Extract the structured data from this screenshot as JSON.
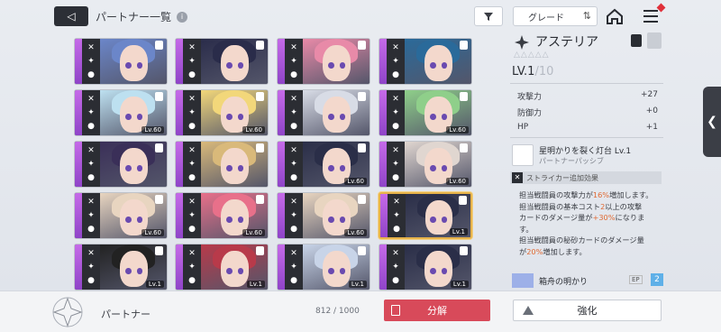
{
  "header": {
    "back_glyph": "◁",
    "title": "パートナー一覧",
    "info_glyph": "i",
    "sort_label": "グレード",
    "sort_order_glyph": "⇅"
  },
  "cards": [
    {
      "level": "",
      "hair": "#6b86c9",
      "selected": false
    },
    {
      "level": "",
      "hair": "#2a2c4a",
      "selected": false
    },
    {
      "level": "",
      "hair": "#e88aa8",
      "selected": false
    },
    {
      "level": "",
      "hair": "#2a6a9a",
      "selected": false
    },
    {
      "level": "Lv.60",
      "hair": "#bde0f0",
      "selected": false
    },
    {
      "level": "Lv.60",
      "hair": "#f2d77a",
      "selected": false
    },
    {
      "level": "",
      "hair": "#d8dce6",
      "selected": false
    },
    {
      "level": "Lv.60",
      "hair": "#8fcf8a",
      "selected": false
    },
    {
      "level": "",
      "hair": "#3a2f58",
      "selected": false
    },
    {
      "level": "",
      "hair": "#d9b97a",
      "selected": false
    },
    {
      "level": "Lv.60",
      "hair": "#2a2e48",
      "selected": false
    },
    {
      "level": "Lv.60",
      "hair": "#e0d6d0",
      "selected": false
    },
    {
      "level": "Lv.60",
      "hair": "#e8d5c0",
      "selected": false
    },
    {
      "level": "Lv.60",
      "hair": "#e8708a",
      "selected": false
    },
    {
      "level": "Lv.60",
      "hair": "#e8d5c0",
      "selected": false
    },
    {
      "level": "Lv.1",
      "hair": "#2a2e48",
      "selected": true
    },
    {
      "level": "Lv.1",
      "hair": "#222",
      "selected": false
    },
    {
      "level": "Lv.1",
      "hair": "#b83a4a",
      "selected": false
    },
    {
      "level": "Lv.1",
      "hair": "#c8d4e8",
      "selected": false
    },
    {
      "level": "Lv.1",
      "hair": "#2a2e48",
      "selected": false
    }
  ],
  "detail": {
    "name": "アステリア",
    "rank_stars": "△△△△△",
    "level": "LV.1",
    "level_max": "/10",
    "stats": [
      {
        "label": "攻撃力",
        "value": "+27"
      },
      {
        "label": "防御力",
        "value": "+0"
      },
      {
        "label": "HP",
        "value": "+1"
      }
    ],
    "skill_name": "星明かりを裂く灯台 Lv.1",
    "skill_type": "パートナーパッシブ",
    "tag": "ストライカー追加効果",
    "desc_lines": [
      [
        "担当戦闘員の攻撃力が",
        "16%",
        "増加します。"
      ],
      [
        "担当戦闘員の基本コスト",
        "2",
        "以上の攻撃"
      ],
      [
        "カードのダメージ量が",
        "+30%",
        "になりま"
      ],
      [
        "す。",
        "",
        ""
      ],
      [
        "担当戦闘員の秘砂カードのダメージ量",
        "",
        ""
      ],
      [
        "が",
        "20%",
        "増加します。"
      ]
    ],
    "ship_name": "箱舟の明かり",
    "ep_label": "EP",
    "ep_value": "2"
  },
  "footer": {
    "label": "パートナー",
    "count": "812 / 1000",
    "dismantle": "分解",
    "enhance": "強化"
  },
  "colors": {
    "accent_red": "#d84a5a",
    "highlight": "#e06a34",
    "selected_border": "#e7b34a"
  }
}
